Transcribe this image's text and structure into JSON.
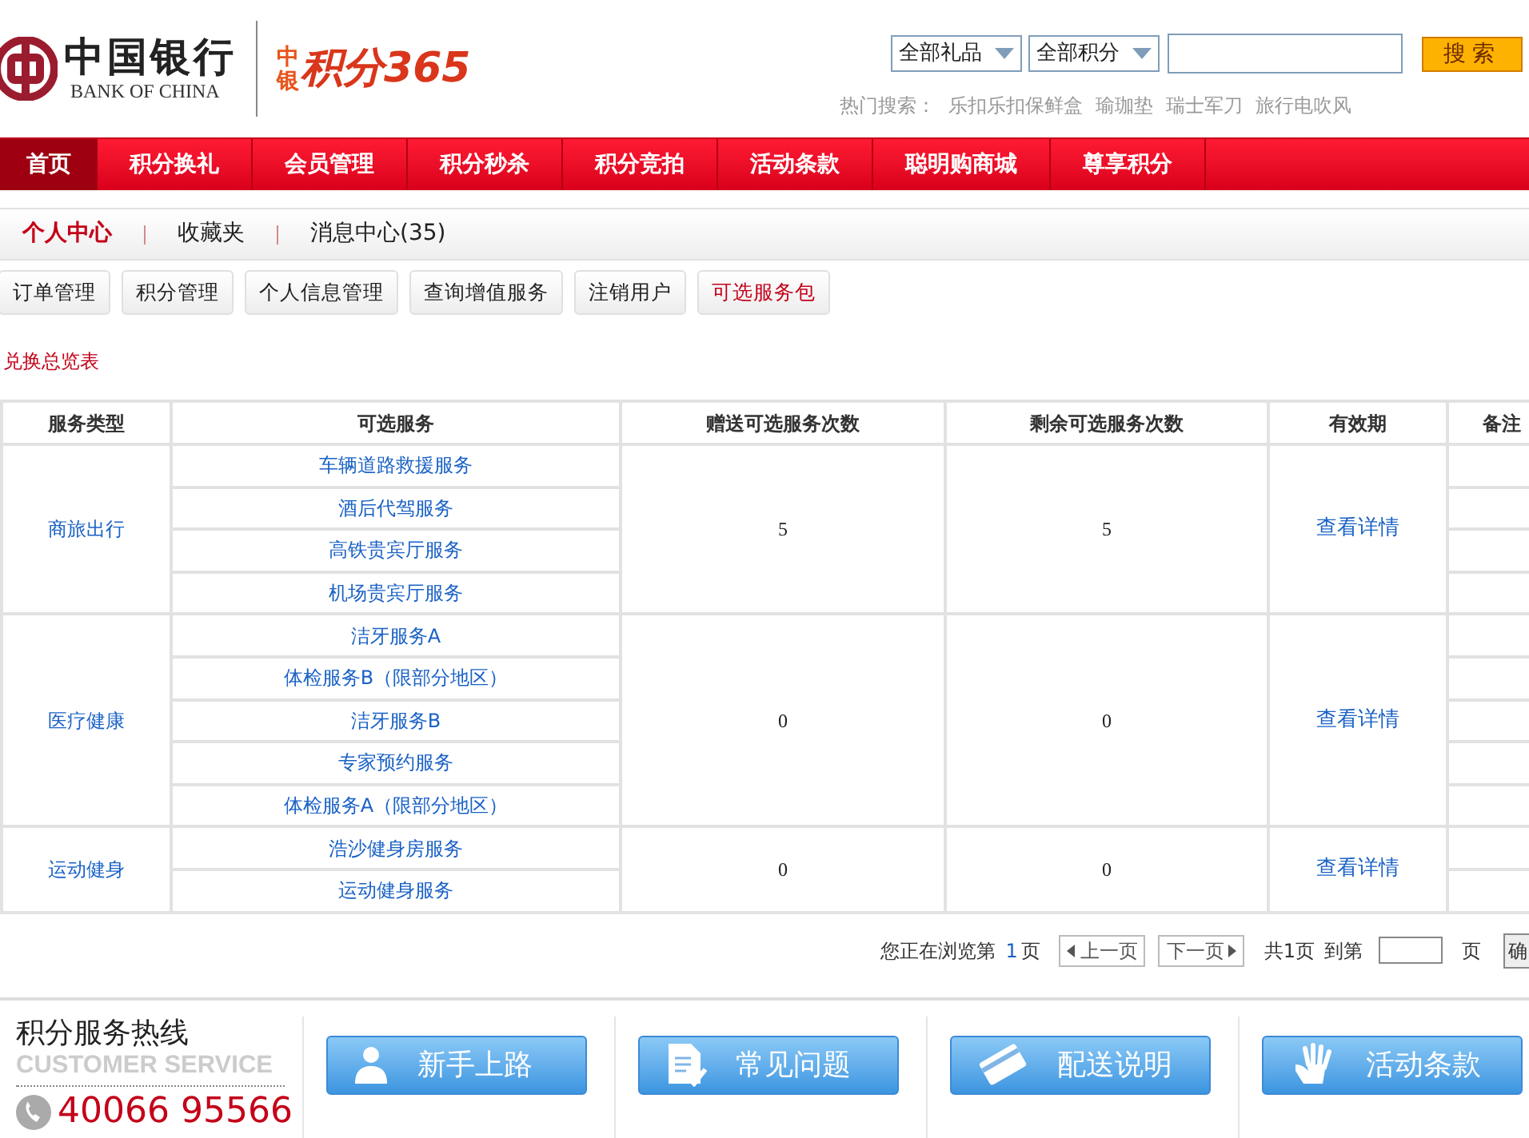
{
  "logo": {
    "name": "中国银行",
    "subtitle": "BANK OF CHINA",
    "brand_small": "中银",
    "brand_large": "积分365"
  },
  "search": {
    "category": "全部礼品",
    "points": "全部积分",
    "button": "搜索",
    "hot_label": "热门搜索：",
    "hot_terms": [
      "乐扣乐扣保鲜盒",
      "瑜珈垫",
      "瑞士军刀",
      "旅行电吹风"
    ]
  },
  "nav": [
    {
      "label": "首页",
      "selected": true
    },
    {
      "label": "积分换礼",
      "selected": false
    },
    {
      "label": "会员管理",
      "selected": false
    },
    {
      "label": "积分秒杀",
      "selected": false
    },
    {
      "label": "积分竞拍",
      "selected": false
    },
    {
      "label": "活动条款",
      "selected": false
    },
    {
      "label": "聪明购商城",
      "selected": false
    },
    {
      "label": "尊享积分",
      "selected": false
    }
  ],
  "subnav": [
    {
      "label": "个人中心",
      "selected": true
    },
    {
      "label": "收藏夹",
      "selected": false
    },
    {
      "label": "消息中心(35)",
      "selected": false
    }
  ],
  "tabs": [
    {
      "label": "订单管理",
      "selected": false
    },
    {
      "label": "积分管理",
      "selected": false
    },
    {
      "label": "个人信息管理",
      "selected": false
    },
    {
      "label": "查询增值服务",
      "selected": false
    },
    {
      "label": "注销用户",
      "selected": false
    },
    {
      "label": "可选服务包",
      "selected": true
    }
  ],
  "section_title": "兑换总览表",
  "table": {
    "columns": [
      "服务类型",
      "可选服务",
      "赠送可选服务次数",
      "剩余可选服务次数",
      "有效期",
      "备注"
    ],
    "groups": [
      {
        "type": "商旅出行",
        "services": [
          "车辆道路救援服务",
          "酒后代驾服务",
          "高铁贵宾厅服务",
          "机场贵宾厅服务"
        ],
        "gifted": "5",
        "remaining": "5",
        "validity": "查看详情"
      },
      {
        "type": "医疗健康",
        "services": [
          "洁牙服务A",
          "体检服务B（限部分地区）",
          "洁牙服务B",
          "专家预约服务",
          "体检服务A（限部分地区）"
        ],
        "gifted": "0",
        "remaining": "0",
        "validity": "查看详情"
      },
      {
        "type": "运动健身",
        "services": [
          "浩沙健身房服务",
          "运动健身服务"
        ],
        "gifted": "0",
        "remaining": "0",
        "validity": "查看详情"
      }
    ]
  },
  "pagination": {
    "browsing": "您正在浏览第",
    "current": "1",
    "page_unit": "页",
    "prev": "上一页",
    "next": "下一页",
    "total": "共1页",
    "goto": "到第",
    "goto_unit": "页",
    "confirm": "确"
  },
  "footer": {
    "hotline_title": "积分服务热线",
    "hotline_subtitle": "CUSTOMER SERVICE",
    "phone": "40066 95566",
    "buttons": [
      {
        "label": "新手上路",
        "kind": "person"
      },
      {
        "label": "常见问题",
        "kind": "document"
      },
      {
        "label": "配送说明",
        "kind": "card"
      },
      {
        "label": "活动条款",
        "kind": "hand"
      }
    ]
  }
}
